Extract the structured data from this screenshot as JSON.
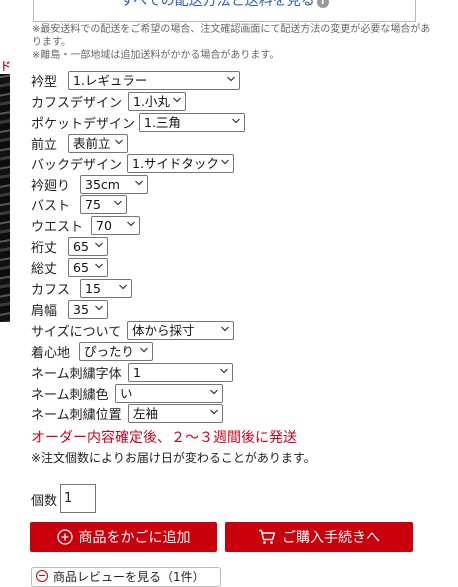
{
  "shipping": {
    "link_label": "すべての配送方法と送料を見る",
    "info_icon": "i",
    "notes": [
      "※最安送料での配送をご希望の場合、注文確認画面にて配送方法の変更が必要な場合があります。",
      "※離島・一部地域は追加送料がかかる場合があります。"
    ]
  },
  "left_image_text": "ド",
  "options": {
    "collar": {
      "label": "衿型",
      "value": "1.レギュラー"
    },
    "cuff_design": {
      "label": "カフスデザイン",
      "value": "1.小丸"
    },
    "pocket_design": {
      "label": "ポケットデザイン",
      "value": "1.三角"
    },
    "front": {
      "label": "前立",
      "value": "表前立"
    },
    "back_design": {
      "label": "バックデザイン",
      "value": "1.サイドタック"
    },
    "neck": {
      "label": "衿廻り",
      "value": "35cm"
    },
    "bust": {
      "label": "バスト",
      "value": "75"
    },
    "waist": {
      "label": "ウエスト",
      "value": "70"
    },
    "sleeve_length": {
      "label": "裄丈",
      "value": "65"
    },
    "total_length": {
      "label": "総丈",
      "value": "65"
    },
    "cuffs": {
      "label": "カフス",
      "value": "15"
    },
    "shoulder": {
      "label": "肩幅",
      "value": "35"
    },
    "size_about": {
      "label": "サイズについて",
      "value": "体から採寸"
    },
    "fit": {
      "label": "着心地",
      "value": "ぴったり"
    },
    "name_font": {
      "label": "ネーム刺繍字体",
      "value": "1"
    },
    "name_color": {
      "label": "ネーム刺繍色",
      "value": "い"
    },
    "name_position": {
      "label": "ネーム刺繍位置",
      "value": "左袖"
    }
  },
  "delivery_notice": "オーダー内容確定後、２～３週間後に発送",
  "delivery_note": "※注文個数によりお届け日が変わることがあります。",
  "quantity": {
    "label": "個数",
    "value": "1"
  },
  "buttons": {
    "add_to_cart": "商品をかごに追加",
    "checkout": "ご購入手続きへ"
  },
  "review_label": "商品レビューを見る（1件）",
  "colors": {
    "accent": "#c9000b",
    "notice": "#d0021b",
    "link": "#2a5db0"
  }
}
